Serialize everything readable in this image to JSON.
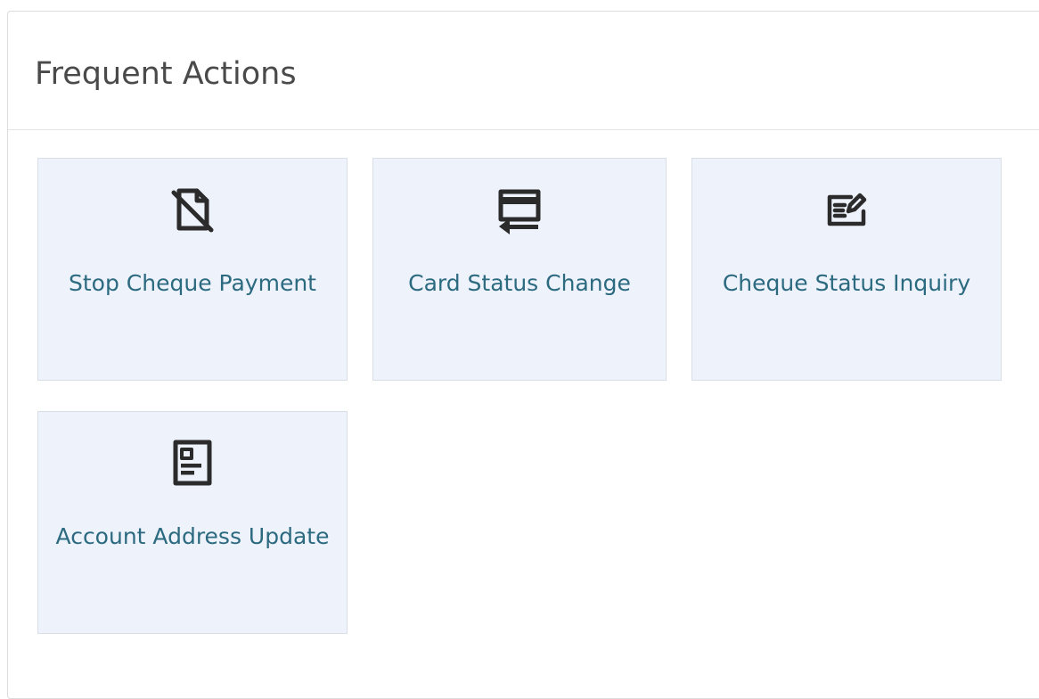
{
  "panel": {
    "title": "Frequent Actions"
  },
  "actions": [
    {
      "label": "Stop Cheque Payment",
      "icon": "stop-cheque-icon"
    },
    {
      "label": "Card Status Change",
      "icon": "card-swap-icon"
    },
    {
      "label": "Cheque Status Inquiry",
      "icon": "edit-document-icon"
    },
    {
      "label": "Account Address Update",
      "icon": "address-card-icon"
    }
  ],
  "colors": {
    "tile_background": "#eef2fb",
    "tile_text": "#2c6a80",
    "title_text": "#4a4a4a",
    "icon": "#2b2b2b"
  }
}
